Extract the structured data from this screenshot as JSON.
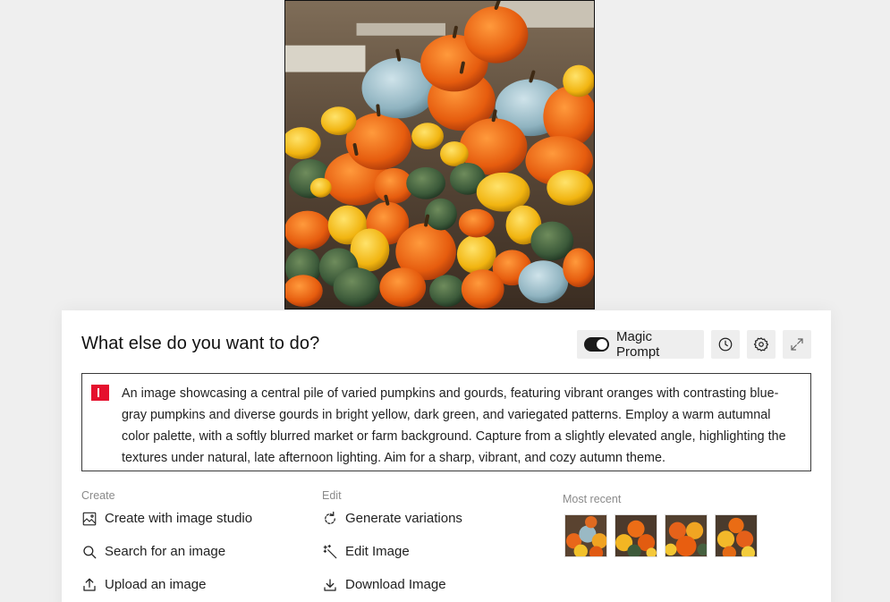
{
  "hero_image": {
    "alt": "pile of pumpkins and gourds"
  },
  "panel": {
    "title": "What else do you want to do?",
    "toolbar": {
      "magic_prompt_label": "Magic Prompt",
      "magic_prompt_enabled": true,
      "history_icon": "clock-icon",
      "settings_icon": "gear-icon",
      "expand_icon": "expand-icon"
    },
    "prompt": {
      "text": "An image showcasing a central pile of varied pumpkins and gourds, featuring vibrant oranges with contrasting blue-gray pumpkins and diverse gourds in bright yellow, dark green, and variegated patterns. Employ a warm autumnal color palette, with a softly blurred market or farm background. Capture from a slightly elevated angle, highlighting the textures under natural, late afternoon lighting. Aim for a sharp, vibrant, and cozy autumn theme.",
      "badge_color": "#e5102d"
    },
    "create": {
      "heading": "Create",
      "items": [
        {
          "label": "Create with image studio",
          "icon": "image-studio-icon"
        },
        {
          "label": "Search for an image",
          "icon": "search-icon"
        },
        {
          "label": "Upload an image",
          "icon": "upload-icon"
        }
      ]
    },
    "edit": {
      "heading": "Edit",
      "items": [
        {
          "label": "Generate variations",
          "icon": "refresh-icon"
        },
        {
          "label": "Edit Image",
          "icon": "magic-wand-icon"
        },
        {
          "label": "Download Image",
          "icon": "download-icon"
        }
      ]
    },
    "recent": {
      "heading": "Most recent",
      "thumbnail_count": 4
    }
  },
  "colors": {
    "background": "#efefef",
    "panel": "#ffffff",
    "accent": "#e5102d",
    "toggle": "#1a1a1a"
  }
}
